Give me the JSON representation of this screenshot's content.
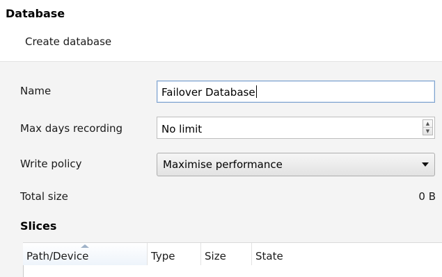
{
  "header": {
    "title": "Database",
    "subtitle": "Create database"
  },
  "form": {
    "name_label": "Name",
    "name_value": "Failover Database",
    "max_days_label": "Max days recording",
    "max_days_value": "No limit",
    "write_policy_label": "Write policy",
    "write_policy_value": "Maximise performance",
    "total_size_label": "Total size",
    "total_size_value": "0 B"
  },
  "slices": {
    "title": "Slices",
    "columns": [
      "Path/Device",
      "Type",
      "Size",
      "State"
    ]
  },
  "icons": {
    "spin_up": "spin-up-arrow-icon",
    "spin_down": "spin-down-arrow-icon",
    "dropdown": "chevron-down-icon",
    "sort": "sort-ascending-icon"
  },
  "colors": {
    "panel_background": "#f4f4f4",
    "focus_border": "#7da2ce"
  }
}
